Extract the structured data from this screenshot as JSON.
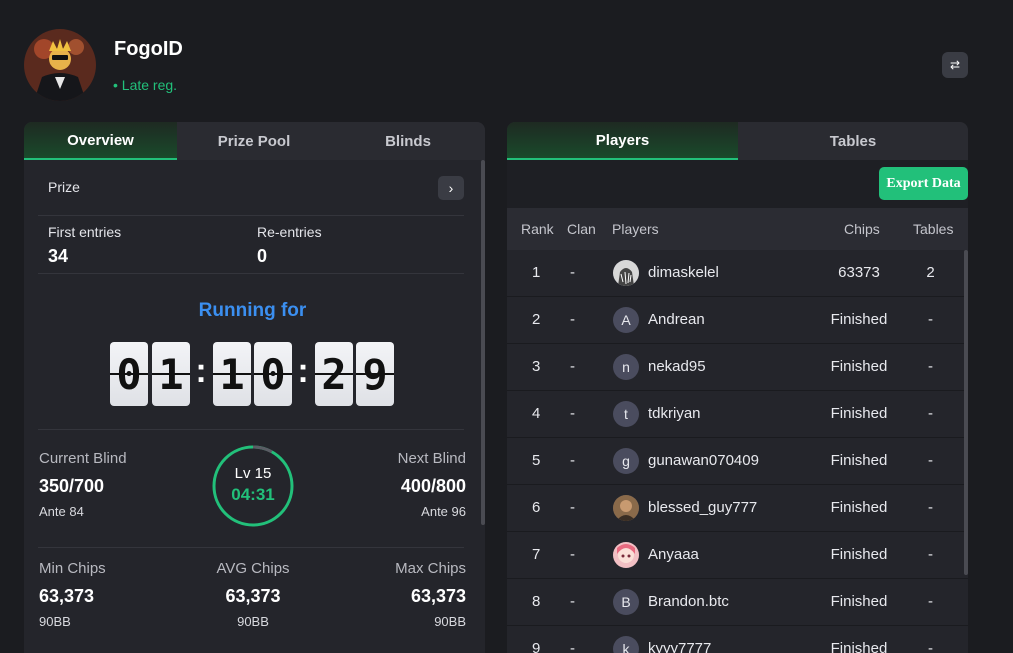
{
  "header": {
    "title": "FogoID",
    "status": "• Late reg."
  },
  "left_tabs": [
    "Overview",
    "Prize Pool",
    "Blinds"
  ],
  "prize": {
    "label": "Prize",
    "arrow": "›"
  },
  "entries": {
    "first_label": "First entries",
    "first_value": "34",
    "re_label": "Re-entries",
    "re_value": "0"
  },
  "timer": {
    "label": "Running for",
    "digits": [
      "0",
      "1",
      "1",
      "0",
      "2",
      "9"
    ]
  },
  "blinds": {
    "current_label": "Current Blind",
    "current_value": "350/700",
    "current_ante": "Ante 84",
    "level": "Lv 15",
    "level_time": "04:31",
    "level_progress": 0.08,
    "next_label": "Next Blind",
    "next_value": "400/800",
    "next_ante": "Ante 96"
  },
  "chips": {
    "min_label": "Min Chips",
    "min_value": "63,373",
    "min_bb": "90BB",
    "avg_label": "AVG Chips",
    "avg_value": "63,373",
    "avg_bb": "90BB",
    "max_label": "Max Chips",
    "max_value": "63,373",
    "max_bb": "90BB"
  },
  "right_tabs": [
    "Players",
    "Tables"
  ],
  "export_label": "Export Data",
  "table": {
    "headers": [
      "Rank",
      "Clan",
      "Players",
      "Chips",
      "Tables"
    ],
    "rows": [
      {
        "rank": "1",
        "clan": "-",
        "avatar": "",
        "player": "dimaskelel",
        "chips": "63373",
        "tables": "2"
      },
      {
        "rank": "2",
        "clan": "-",
        "avatar": "A",
        "player": "Andrean",
        "chips": "Finished",
        "tables": "-"
      },
      {
        "rank": "3",
        "clan": "-",
        "avatar": "n",
        "player": "nekad95",
        "chips": "Finished",
        "tables": "-"
      },
      {
        "rank": "4",
        "clan": "-",
        "avatar": "t",
        "player": "tdkriyan",
        "chips": "Finished",
        "tables": "-"
      },
      {
        "rank": "5",
        "clan": "-",
        "avatar": "g",
        "player": "gunawan070409",
        "chips": "Finished",
        "tables": "-"
      },
      {
        "rank": "6",
        "clan": "-",
        "avatar": "",
        "player": "blessed_guy777",
        "chips": "Finished",
        "tables": "-"
      },
      {
        "rank": "7",
        "clan": "-",
        "avatar": "",
        "player": "Anyaaa",
        "chips": "Finished",
        "tables": "-"
      },
      {
        "rank": "8",
        "clan": "-",
        "avatar": "B",
        "player": "Brandon.btc",
        "chips": "Finished",
        "tables": "-"
      },
      {
        "rank": "9",
        "clan": "-",
        "avatar": "k",
        "player": "kyyy7777",
        "chips": "Finished",
        "tables": "-"
      }
    ]
  },
  "colors": {
    "accent_green": "#22c07a",
    "accent_blue": "#3b8ff0",
    "background": "#1b1c20",
    "panel": "#24252b"
  }
}
